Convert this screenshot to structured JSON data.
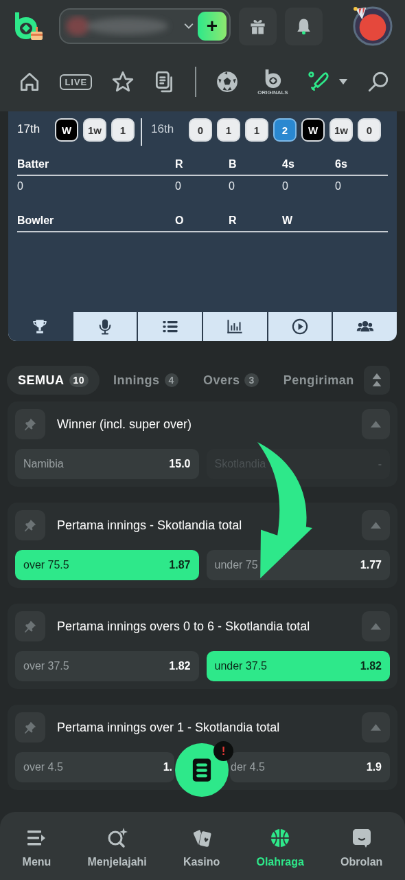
{
  "header": {
    "add_button": {
      "label": "+"
    }
  },
  "nav": [
    {
      "kind": "home",
      "selected": false
    },
    {
      "kind": "live",
      "label": "LIVE",
      "selected": false
    },
    {
      "kind": "star",
      "selected": false
    },
    {
      "kind": "docs",
      "selected": false
    },
    {
      "kind": "divider"
    },
    {
      "kind": "soccer",
      "selected": false
    },
    {
      "kind": "originals",
      "label": "ORIGINALS",
      "selected": false
    },
    {
      "kind": "cricket",
      "selected": true
    },
    {
      "kind": "caret"
    },
    {
      "kind": "search",
      "selected": false
    }
  ],
  "scoreboard": {
    "overs": [
      {
        "label": "17th",
        "selected": true,
        "balls": [
          {
            "value": "W",
            "kind": "wicket"
          },
          {
            "value": "1w",
            "kind": "run"
          },
          {
            "value": "1",
            "kind": "run"
          }
        ]
      },
      {
        "label": "16th",
        "selected": false,
        "balls": [
          {
            "value": "0",
            "kind": "run"
          },
          {
            "value": "1",
            "kind": "run"
          },
          {
            "value": "1",
            "kind": "run"
          },
          {
            "value": "2",
            "kind": "highlight"
          },
          {
            "value": "W",
            "kind": "wicket"
          },
          {
            "value": "1w",
            "kind": "run"
          },
          {
            "value": "0",
            "kind": "run"
          }
        ]
      }
    ],
    "batting": {
      "columns": [
        "Batter",
        "R",
        "B",
        "4s",
        "6s"
      ],
      "rows": [
        [
          "0",
          "0",
          "0",
          "0",
          "0"
        ]
      ]
    },
    "bowling": {
      "columns": [
        "Bowler",
        "O",
        "R",
        "W"
      ]
    },
    "tabs": [
      {
        "kind": "trophy",
        "selected": true
      },
      {
        "kind": "mic",
        "selected": false
      },
      {
        "kind": "list",
        "selected": false
      },
      {
        "kind": "chart",
        "selected": false
      },
      {
        "kind": "play",
        "selected": false
      },
      {
        "kind": "people",
        "selected": false
      }
    ]
  },
  "filters": [
    {
      "label": "SEMUA",
      "count": "10",
      "selected": true
    },
    {
      "label": "Innings",
      "count": "4",
      "selected": false
    },
    {
      "label": "Overs",
      "count": "3",
      "selected": false
    },
    {
      "label": "Pengiriman",
      "selected": false
    }
  ],
  "markets": [
    {
      "title": "Winner (incl. super over)",
      "outcomes": [
        {
          "label": "Namibia",
          "odds": "15.0",
          "selected": false,
          "disabled": false
        },
        {
          "label": "Skotlandia",
          "odds": "-",
          "selected": false,
          "disabled": true
        }
      ]
    },
    {
      "title": "Pertama innings - Skotlandia total",
      "outcomes": [
        {
          "label": "over 75.5",
          "odds": "1.87",
          "selected": true,
          "disabled": false
        },
        {
          "label": "under 75",
          "odds": "1.77",
          "selected": false,
          "disabled": false
        }
      ]
    },
    {
      "title": "Pertama innings overs 0 to 6 - Skotlandia total",
      "outcomes": [
        {
          "label": "over 37.5",
          "odds": "1.82",
          "selected": false,
          "disabled": false
        },
        {
          "label": "under 37.5",
          "odds": "1.82",
          "selected": true,
          "disabled": false
        }
      ]
    },
    {
      "title": "Pertama innings over 1 - Skotlandia total",
      "outcomes": [
        {
          "label": "over 4.5",
          "odds": "1.",
          "selected": false,
          "disabled": false
        },
        {
          "label": "der 4.5",
          "odds": "1.9",
          "selected": false,
          "disabled": false
        }
      ]
    }
  ],
  "bet_slip": {
    "badge": "!"
  },
  "bottom_nav": [
    {
      "kind": "menu",
      "label": "Menu",
      "selected": false
    },
    {
      "kind": "explore",
      "label": "Menjelajahi",
      "selected": false
    },
    {
      "kind": "cards",
      "label": "Kasino",
      "selected": false
    },
    {
      "kind": "ball",
      "label": "Olahraga",
      "selected": true
    },
    {
      "kind": "chat",
      "label": "Obrolan",
      "selected": false
    }
  ]
}
